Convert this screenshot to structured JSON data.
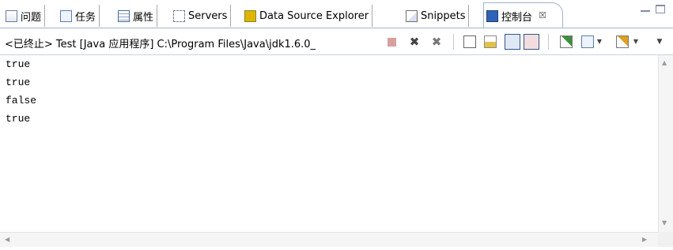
{
  "tabs": [
    {
      "label": "问题",
      "icon": "problems-icon"
    },
    {
      "label": "任务",
      "icon": "tasks-icon"
    },
    {
      "label": "属性",
      "icon": "properties-icon"
    },
    {
      "label": "Servers",
      "icon": "servers-icon"
    },
    {
      "label": "Data Source Explorer",
      "icon": "data-source-icon"
    },
    {
      "label": "Snippets",
      "icon": "snippets-icon"
    },
    {
      "label": "控制台",
      "icon": "console-icon",
      "active": true,
      "close": "☒"
    }
  ],
  "toolbar": {
    "process_label": "<已终止> Test [Java 应用程序] C:\\Program Files\\Java\\jdk1.6.0_"
  },
  "console": {
    "lines": [
      "true",
      "true",
      "false",
      "true"
    ]
  },
  "colors": {
    "tab_border": "#9fb3cc",
    "accent_blue": "#2f63b6",
    "terminate_red": "#d9a0a0"
  }
}
